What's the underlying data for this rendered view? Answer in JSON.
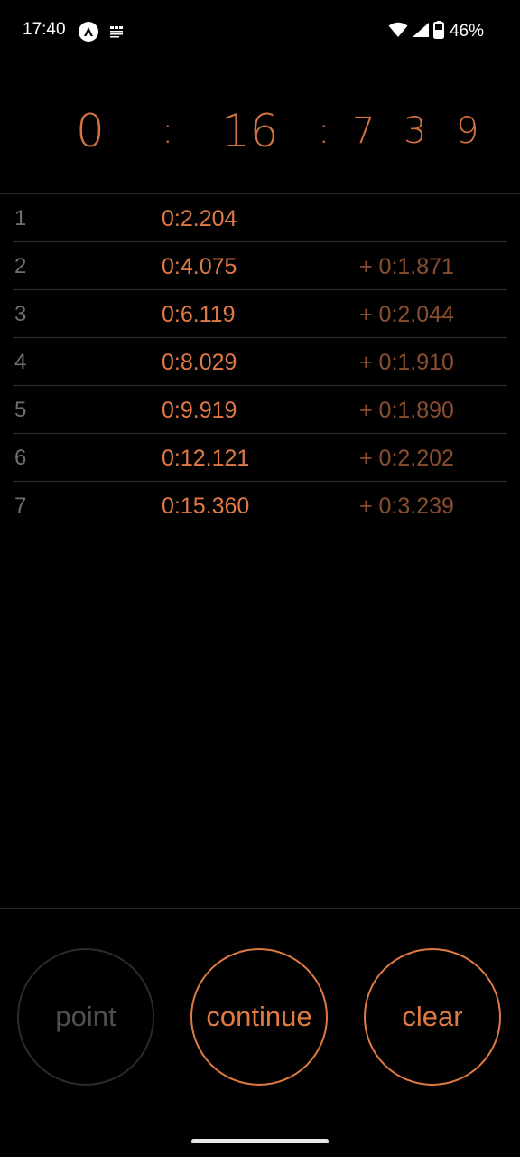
{
  "status_bar": {
    "time": "17:40",
    "battery_percent": "46%",
    "icons": [
      "app-a-icon",
      "news-icon",
      "wifi-icon",
      "signal-icon",
      "battery-icon"
    ]
  },
  "timer": {
    "minutes": "0",
    "colon1": ":",
    "seconds": "16",
    "colon2": ":",
    "d1": "7",
    "d2": "3",
    "d3": "9"
  },
  "laps": [
    {
      "num": "1",
      "total": "0:2.204",
      "diff": ""
    },
    {
      "num": "2",
      "total": "0:4.075",
      "diff": "+ 0:1.871"
    },
    {
      "num": "3",
      "total": "0:6.119",
      "diff": "+ 0:2.044"
    },
    {
      "num": "4",
      "total": "0:8.029",
      "diff": "+ 0:1.910"
    },
    {
      "num": "5",
      "total": "0:9.919",
      "diff": "+ 0:1.890"
    },
    {
      "num": "6",
      "total": "0:12.121",
      "diff": "+ 0:2.202"
    },
    {
      "num": "7",
      "total": "0:15.360",
      "diff": "+ 0:3.239"
    }
  ],
  "buttons": {
    "point": "point",
    "continue": "continue",
    "clear": "clear"
  },
  "colors": {
    "accent": "#e07a45",
    "accent_dim": "#8a4d30",
    "muted": "#6f6f6f",
    "background": "#000000"
  }
}
